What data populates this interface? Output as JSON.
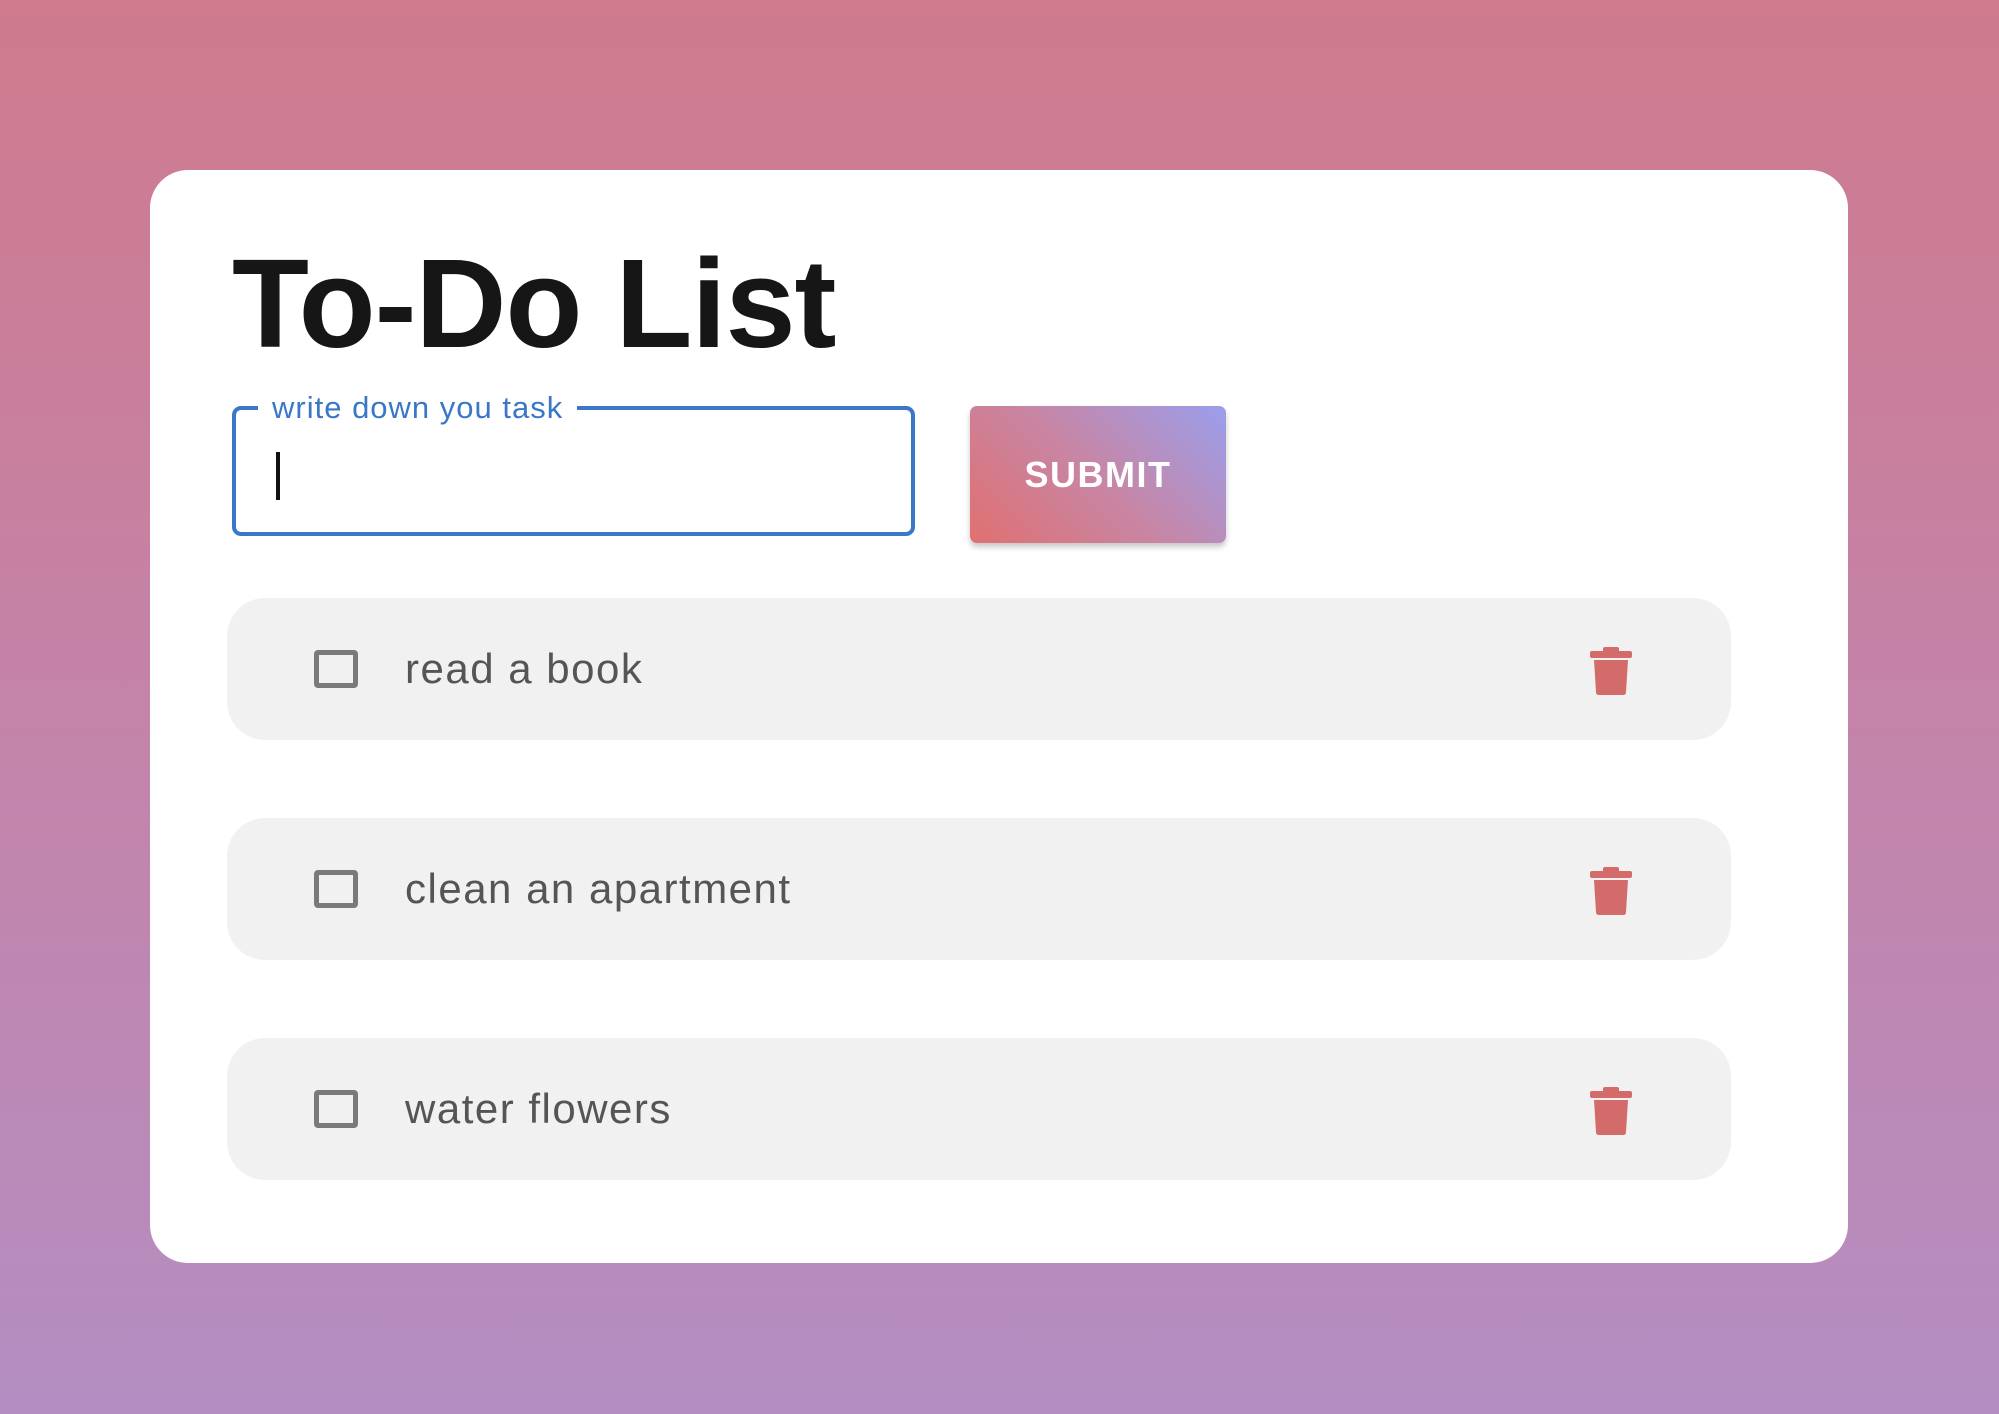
{
  "app": {
    "title": "To-Do List"
  },
  "form": {
    "input_label": "write down you task",
    "input_value": "",
    "submit_label": "SUBMIT"
  },
  "tasks": [
    {
      "label": "read a book",
      "checked": false
    },
    {
      "label": "clean an apartment",
      "checked": false
    },
    {
      "label": "water flowers",
      "checked": false
    }
  ],
  "icons": {
    "delete": "trash-icon"
  },
  "colors": {
    "accent_blue": "#3a78c7",
    "delete_icon": "#d36b6b",
    "task_background": "#f1f1f1",
    "title_text": "#161616"
  }
}
